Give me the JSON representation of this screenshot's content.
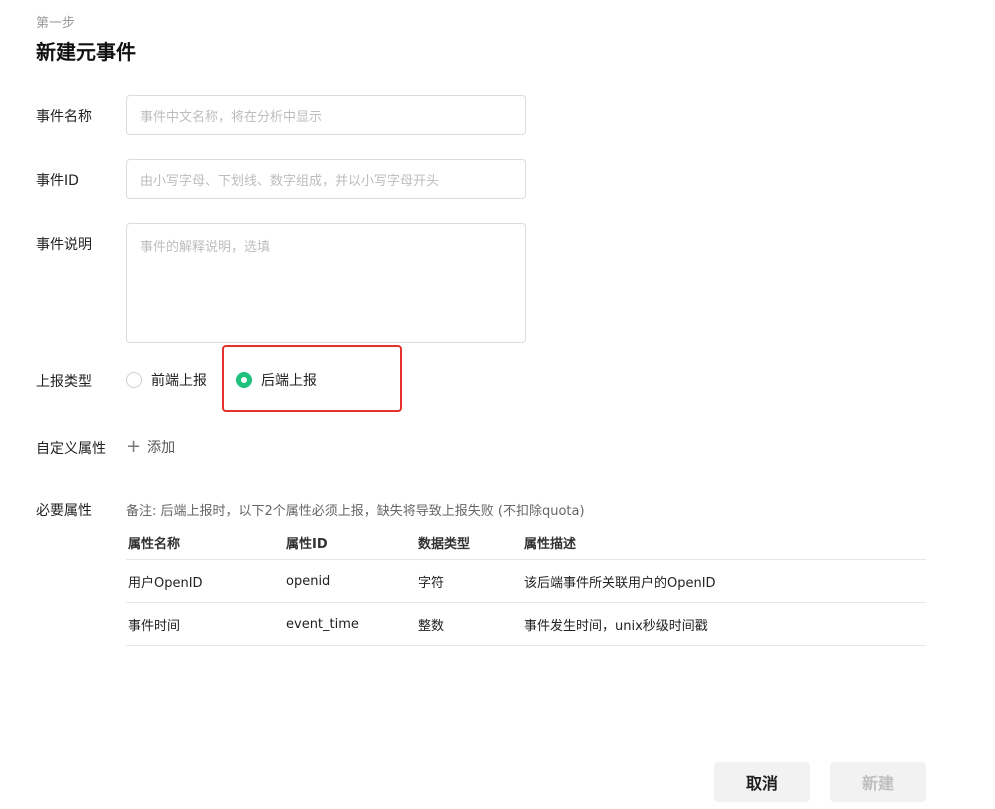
{
  "header": {
    "step": "第一步",
    "title": "新建元事件"
  },
  "form": {
    "name_label": "事件名称",
    "name_placeholder": "事件中文名称，将在分析中显示",
    "id_label": "事件ID",
    "id_placeholder": "由小写字母、下划线、数字组成，并以小写字母开头",
    "desc_label": "事件说明",
    "desc_placeholder": "事件的解释说明，选填",
    "report_label": "上报类型",
    "report_options": [
      "前端上报",
      "后端上报"
    ],
    "report_selected": "后端上报",
    "custom_label": "自定义属性",
    "add_label": "添加",
    "required_label": "必要属性",
    "note": "备注: 后端上报时，以下2个属性必须上报，缺失将导致上报失败 (不扣除quota)"
  },
  "table": {
    "headers": [
      "属性名称",
      "属性ID",
      "数据类型",
      "属性描述"
    ],
    "rows": [
      [
        "用户OpenID",
        "openid",
        "字符",
        "该后端事件所关联用户的OpenID"
      ],
      [
        "事件时间",
        "event_time",
        "整数",
        "事件发生时间，unix秒级时间戳"
      ]
    ]
  },
  "footer": {
    "cancel": "取消",
    "create": "新建"
  },
  "colors": {
    "accent": "#1fc27a",
    "highlight": "#e5322d"
  }
}
